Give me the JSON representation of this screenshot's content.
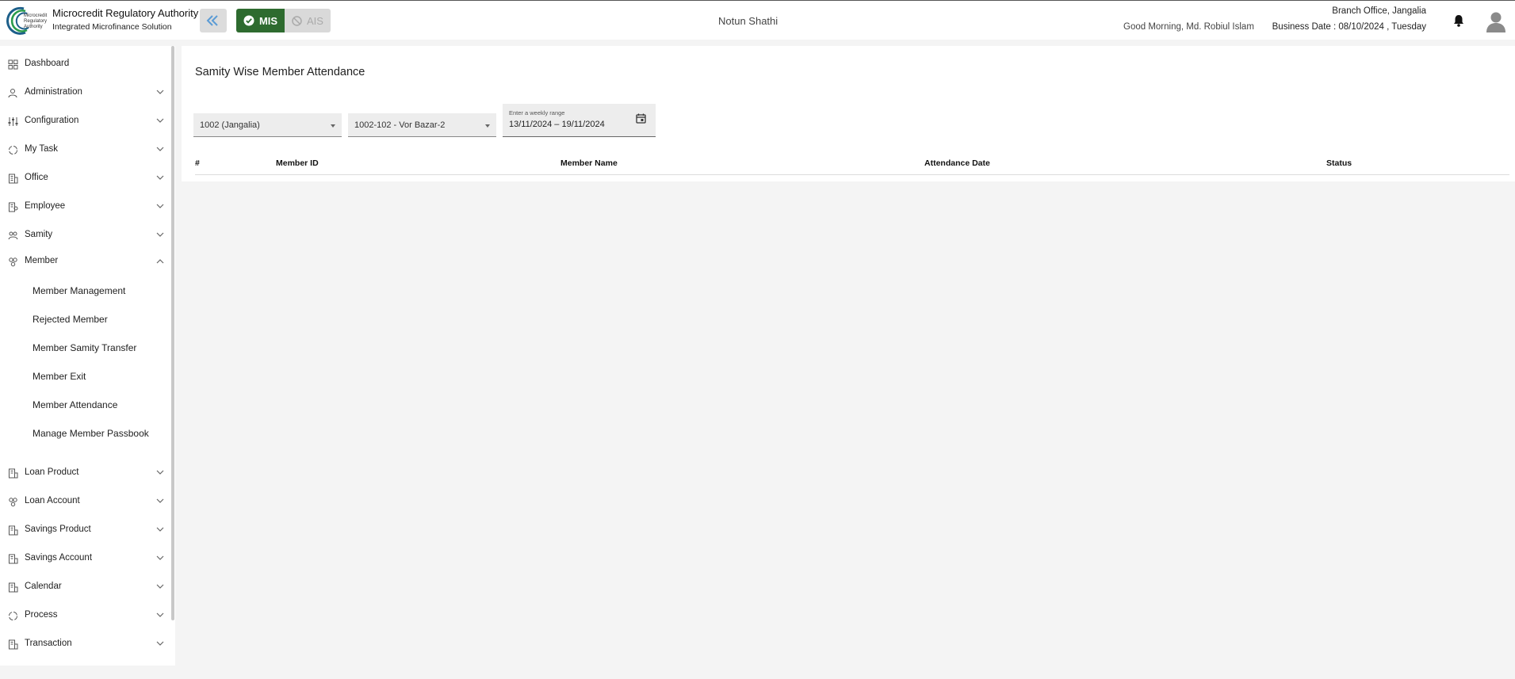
{
  "header": {
    "logo_lines": [
      "Microcredit",
      "Regulatory",
      "Authority"
    ],
    "org_name": "Microcredit Regulatory Authority",
    "org_subtitle": "Integrated Microfinance Solution",
    "mode_mis": "MIS",
    "mode_ais": "AIS",
    "center_title": "Notun Shathi",
    "greeting": "Good Morning, Md. Robiul Islam",
    "branch": "Branch Office, Jangalia",
    "business_date": "Business Date : 08/10/2024 , Tuesday",
    "accent_green": "#2e6b2f"
  },
  "sidebar": {
    "items": [
      {
        "label": "Dashboard",
        "icon": "dashboard-icon",
        "expandable": false
      },
      {
        "label": "Administration",
        "icon": "admin-icon",
        "expandable": true
      },
      {
        "label": "Configuration",
        "icon": "sliders-icon",
        "expandable": true
      },
      {
        "label": "My Task",
        "icon": "task-icon",
        "expandable": true
      },
      {
        "label": "Office",
        "icon": "office-icon",
        "expandable": true
      },
      {
        "label": "Employee",
        "icon": "employee-icon",
        "expandable": true
      },
      {
        "label": "Samity",
        "icon": "samity-icon",
        "expandable": true
      },
      {
        "label": "Member",
        "icon": "member-icon",
        "expandable": true,
        "expanded": true
      },
      {
        "label": "Loan Product",
        "icon": "loan-product-icon",
        "expandable": true
      },
      {
        "label": "Loan Account",
        "icon": "loan-account-icon",
        "expandable": true
      },
      {
        "label": "Savings Product",
        "icon": "savings-product-icon",
        "expandable": true
      },
      {
        "label": "Savings Account",
        "icon": "savings-account-icon",
        "expandable": true
      },
      {
        "label": "Calendar",
        "icon": "calendar-icon",
        "expandable": true
      },
      {
        "label": "Process",
        "icon": "process-icon",
        "expandable": true
      },
      {
        "label": "Transaction",
        "icon": "transaction-icon",
        "expandable": true
      }
    ],
    "member_sub_items": [
      "Member Management",
      "Rejected Member",
      "Member Samity Transfer",
      "Member Exit",
      "Member Attendance",
      "Manage Member Passbook"
    ]
  },
  "main": {
    "title": "Samity Wise Member Attendance",
    "office_select": "1002 (Jangalia)",
    "samity_select": "1002-102 - Vor Bazar-2",
    "date_range_label": "Enter a weekly range",
    "date_range_value": "13/11/2024 – 19/11/2024",
    "table_headers": [
      "#",
      "Member ID",
      "Member Name",
      "Attendance Date",
      "Status"
    ]
  }
}
